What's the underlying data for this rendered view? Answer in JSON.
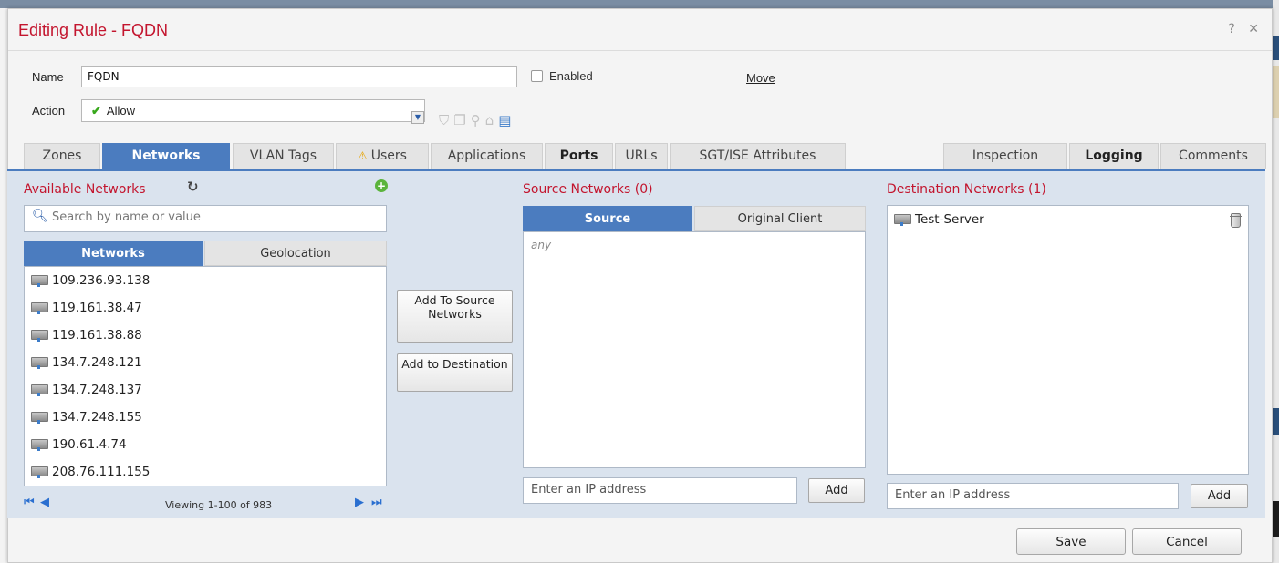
{
  "dialog": {
    "title": "Editing Rule - FQDN",
    "help_label": "?",
    "close_label": "✕"
  },
  "form": {
    "name_label": "Name",
    "name_value": "FQDN",
    "enabled_label": "Enabled",
    "enabled_checked": false,
    "move_label": "Move",
    "action_label": "Action",
    "action_value": "Allow"
  },
  "tabs": [
    {
      "label": "Zones"
    },
    {
      "label": "Networks",
      "active": true
    },
    {
      "label": "VLAN Tags"
    },
    {
      "label": "Users",
      "warning": true
    },
    {
      "label": "Applications"
    },
    {
      "label": "Ports"
    },
    {
      "label": "URLs"
    },
    {
      "label": "SGT/ISE Attributes"
    },
    {
      "label": "Inspection"
    },
    {
      "label": "Logging"
    },
    {
      "label": "Comments"
    }
  ],
  "available": {
    "title": "Available Networks",
    "search_placeholder": "Search by name or value",
    "subtabs": [
      "Networks",
      "Geolocation"
    ],
    "items": [
      "109.236.93.138",
      "119.161.38.47",
      "119.161.38.88",
      "134.7.248.121",
      "134.7.248.137",
      "134.7.248.155",
      "190.61.4.74",
      "208.76.111.155"
    ],
    "pager_text": "Viewing 1-100 of 983"
  },
  "middle": {
    "add_source_label": "Add To Source Networks",
    "add_dest_label": "Add to Destination"
  },
  "source": {
    "title": "Source Networks (0)",
    "subtabs": [
      "Source",
      "Original Client"
    ],
    "empty_text": "any",
    "ip_placeholder": "Enter an IP address",
    "add_label": "Add"
  },
  "destination": {
    "title": "Destination Networks (1)",
    "items": [
      "Test-Server"
    ],
    "ip_placeholder": "Enter an IP address",
    "add_label": "Add"
  },
  "footer": {
    "save_label": "Save",
    "cancel_label": "Cancel"
  },
  "colors": {
    "title_red": "#c3152e",
    "accent_blue": "#4b7cbf",
    "panel_bg": "#dae3ee",
    "allow_green": "#38a81c"
  }
}
